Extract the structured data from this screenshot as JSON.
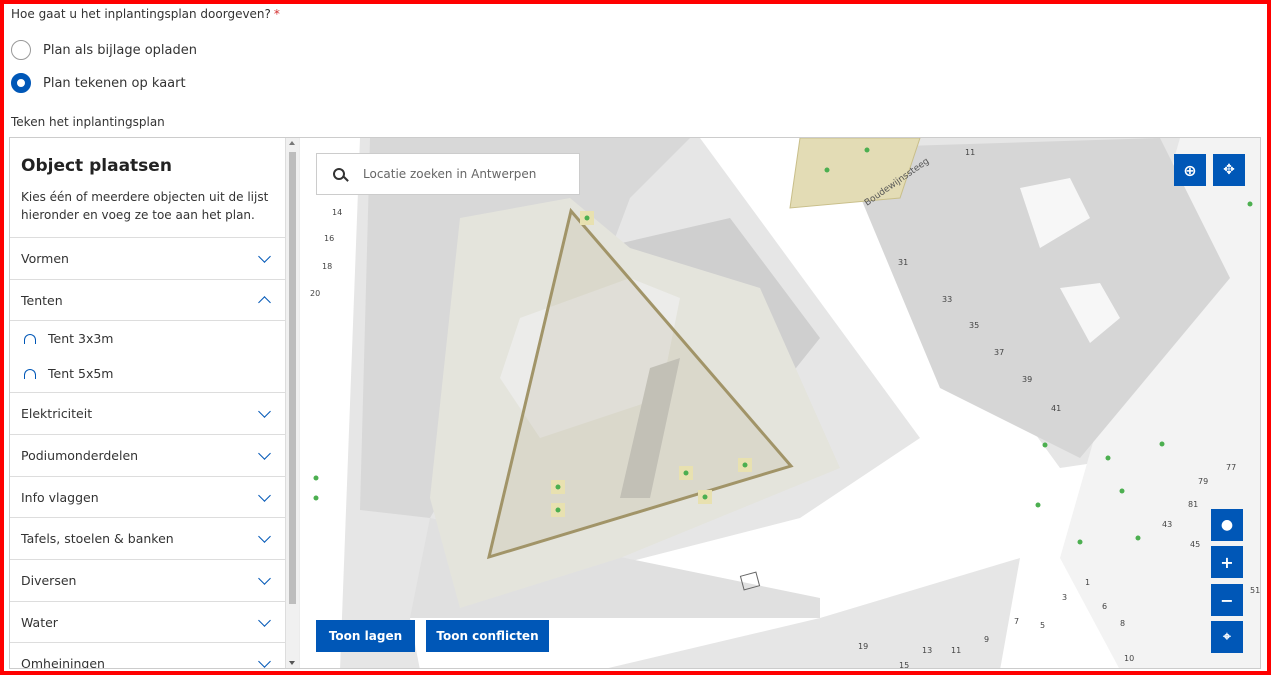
{
  "question": {
    "label": "Hoe gaat u het inplantingsplan doorgeven?",
    "required_mark": "*"
  },
  "options": [
    {
      "label": "Plan als bijlage opladen",
      "selected": false
    },
    {
      "label": "Plan tekenen op kaart",
      "selected": true
    }
  ],
  "draw_label": "Teken het inplantingsplan",
  "panel": {
    "title": "Object plaatsen",
    "intro": "Kies één of meerdere objecten uit de lijst hieronder en voeg ze toe aan het plan.",
    "categories": [
      {
        "label": "Vormen",
        "expanded": false
      },
      {
        "label": "Tenten",
        "expanded": true,
        "items": [
          "Tent 3x3m",
          "Tent 5x5m"
        ]
      },
      {
        "label": "Elektriciteit",
        "expanded": false
      },
      {
        "label": "Podiumonderdelen",
        "expanded": false
      },
      {
        "label": "Info vlaggen",
        "expanded": false
      },
      {
        "label": "Tafels, stoelen & banken",
        "expanded": false
      },
      {
        "label": "Diversen",
        "expanded": false
      },
      {
        "label": "Water",
        "expanded": false
      },
      {
        "label": "Omheiningen",
        "expanded": false
      }
    ]
  },
  "map": {
    "search_placeholder": "Locatie zoeken in Antwerpen",
    "street_name": "Boudewijnssteeg",
    "buttons": {
      "layers": "Toon lagen",
      "conflicts": "Toon conflicten"
    },
    "house_numbers": [
      "14",
      "16",
      "18",
      "20",
      "11",
      "31",
      "33",
      "35",
      "37",
      "39",
      "41",
      "77",
      "79",
      "81",
      "43",
      "45",
      "1",
      "3",
      "5",
      "7",
      "9",
      "6",
      "8",
      "10",
      "11",
      "13",
      "15",
      "19",
      "51"
    ],
    "controls": [
      "zoom-search-icon",
      "fullscreen-icon",
      "globe-icon",
      "plus-icon",
      "minus-icon",
      "locate-icon"
    ]
  },
  "colors": {
    "accent": "#0057b7",
    "frame": "#ff0000",
    "required": "#d32f2f"
  }
}
